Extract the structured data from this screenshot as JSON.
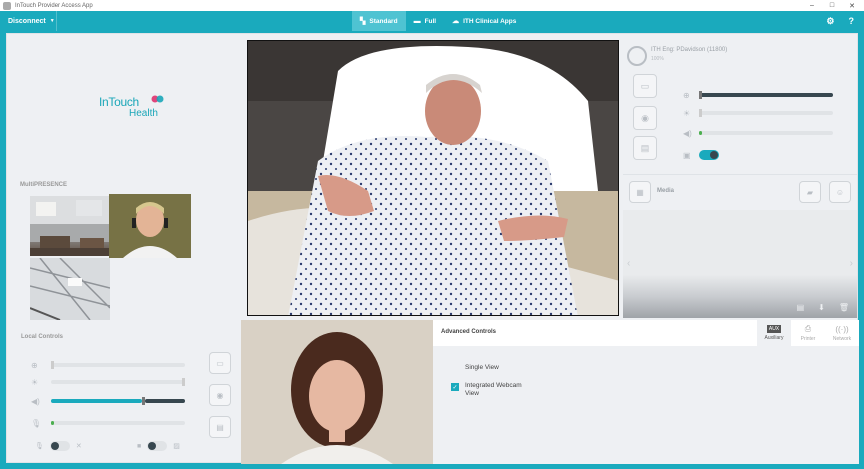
{
  "window": {
    "title": "InTouch Provider Access App",
    "controls": [
      "–",
      "□",
      "✕"
    ]
  },
  "toolbar": {
    "disconnect_label": "Disconnect",
    "tabs": [
      {
        "label": "Standard",
        "active": true
      },
      {
        "label": "Full",
        "active": false
      },
      {
        "label": "ITH Clinical Apps",
        "active": false
      }
    ],
    "help": "?"
  },
  "logo": {
    "brand": "InTouch",
    "sub": "Health"
  },
  "multipresence": {
    "label": "MultiPRESENCE"
  },
  "robot": {
    "name": "ITH Eng: PDavidson (11800)",
    "battery": "100%"
  },
  "media": {
    "label": "Media"
  },
  "local_controls": {
    "label": "Local Controls"
  },
  "advanced": {
    "title": "Advanced Controls",
    "tabs": [
      {
        "label": "Auxiliary",
        "icon_text": "AUX",
        "active": true
      },
      {
        "label": "Printer",
        "active": false
      },
      {
        "label": "Network",
        "active": false
      }
    ],
    "options": [
      {
        "label": "Single View",
        "checked": false
      },
      {
        "label": "Integrated Webcam View",
        "checked": true
      }
    ]
  },
  "colors": {
    "accent": "#1aaabd",
    "background": "#eef0f3"
  }
}
